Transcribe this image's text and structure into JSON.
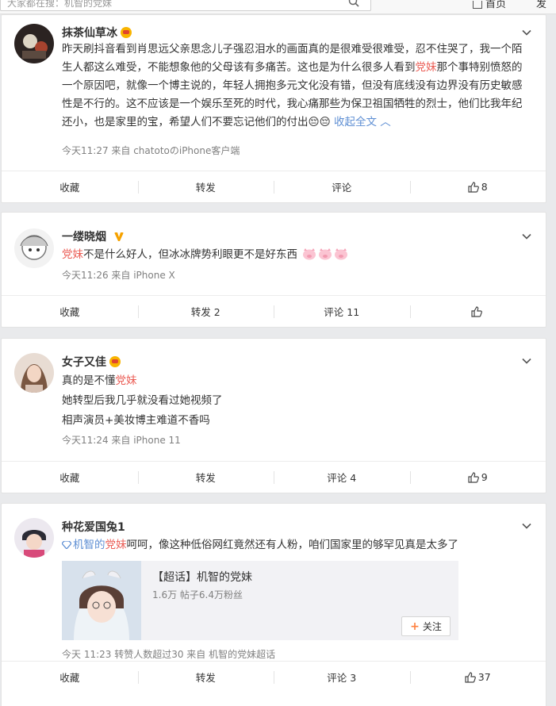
{
  "topbar": {
    "search_placeholder": "大家都在搜：机智的党妹",
    "nav_home": "首页",
    "nav_more": "发"
  },
  "posts": [
    {
      "username": "抹茶仙草冰",
      "text_parts": [
        "昨天刷抖音看到肖思远父亲思念儿子强忍泪水的画面真的是很难受很难受，忍不住哭了，我一个陌生人都这么难受，不能想象他的父母该有多痛苦。这也是为什么很多人看到",
        "党妹",
        "那个事特别愤怒的一个原因吧，就像一个博主说的，年轻人拥抱多元文化没有错，但没有底线没有边界没有历史敏感性是不行的。这不应该是一个娱乐至死的时代，我心痛那些为保卫祖国牺牲的烈士，他们比我年纪还小，也是家里的宝，希望人们不要忘记他们的付出",
        "😔😔"
      ],
      "collapse_label": "收起全文",
      "meta": "今天11:27  来自 chatotoのiPhone客户端",
      "actions": {
        "fav": "收藏",
        "repost": "转发",
        "comment": "评论",
        "like": "8"
      }
    },
    {
      "username": "一缕晓烟",
      "text_parts": [
        "党妹",
        "不是什么好人，但冰冰牌势利眼更不是好东西"
      ],
      "meta": "今天11:26  来自 iPhone X",
      "actions": {
        "fav": "收藏",
        "repost": "转发 2",
        "comment": "评论 11",
        "like": ""
      }
    },
    {
      "username": "女子又佳",
      "lines": [
        {
          "a": "真的是不懂",
          "b": "党妹"
        },
        {
          "a": "她转型后我几乎就没看过她视频了",
          "b": ""
        },
        {
          "a": "相声演员+美妆博主难道不香吗",
          "b": ""
        }
      ],
      "meta": "今天11:24  来自 iPhone 11",
      "actions": {
        "fav": "收藏",
        "repost": "转发",
        "comment": "评论 4",
        "like": "9"
      }
    },
    {
      "username": "种花爱国兔1",
      "text_link_a": "机智的",
      "text_link_b": "党妹",
      "text_rest": "呵呵，像这种低俗网红竟然还有人粉，咱们国家里的够罕见真是太多了",
      "topic": {
        "title": "【超话】机智的党妹",
        "sub": "1.6万  帖子6.4万粉丝",
        "follow": "关注"
      },
      "meta": "今天 11:23  转赞人数超过30  来自 机智的党妹超话",
      "actions": {
        "fav": "收藏",
        "repost": "转发",
        "comment": "评论 3",
        "like": "37"
      }
    }
  ]
}
